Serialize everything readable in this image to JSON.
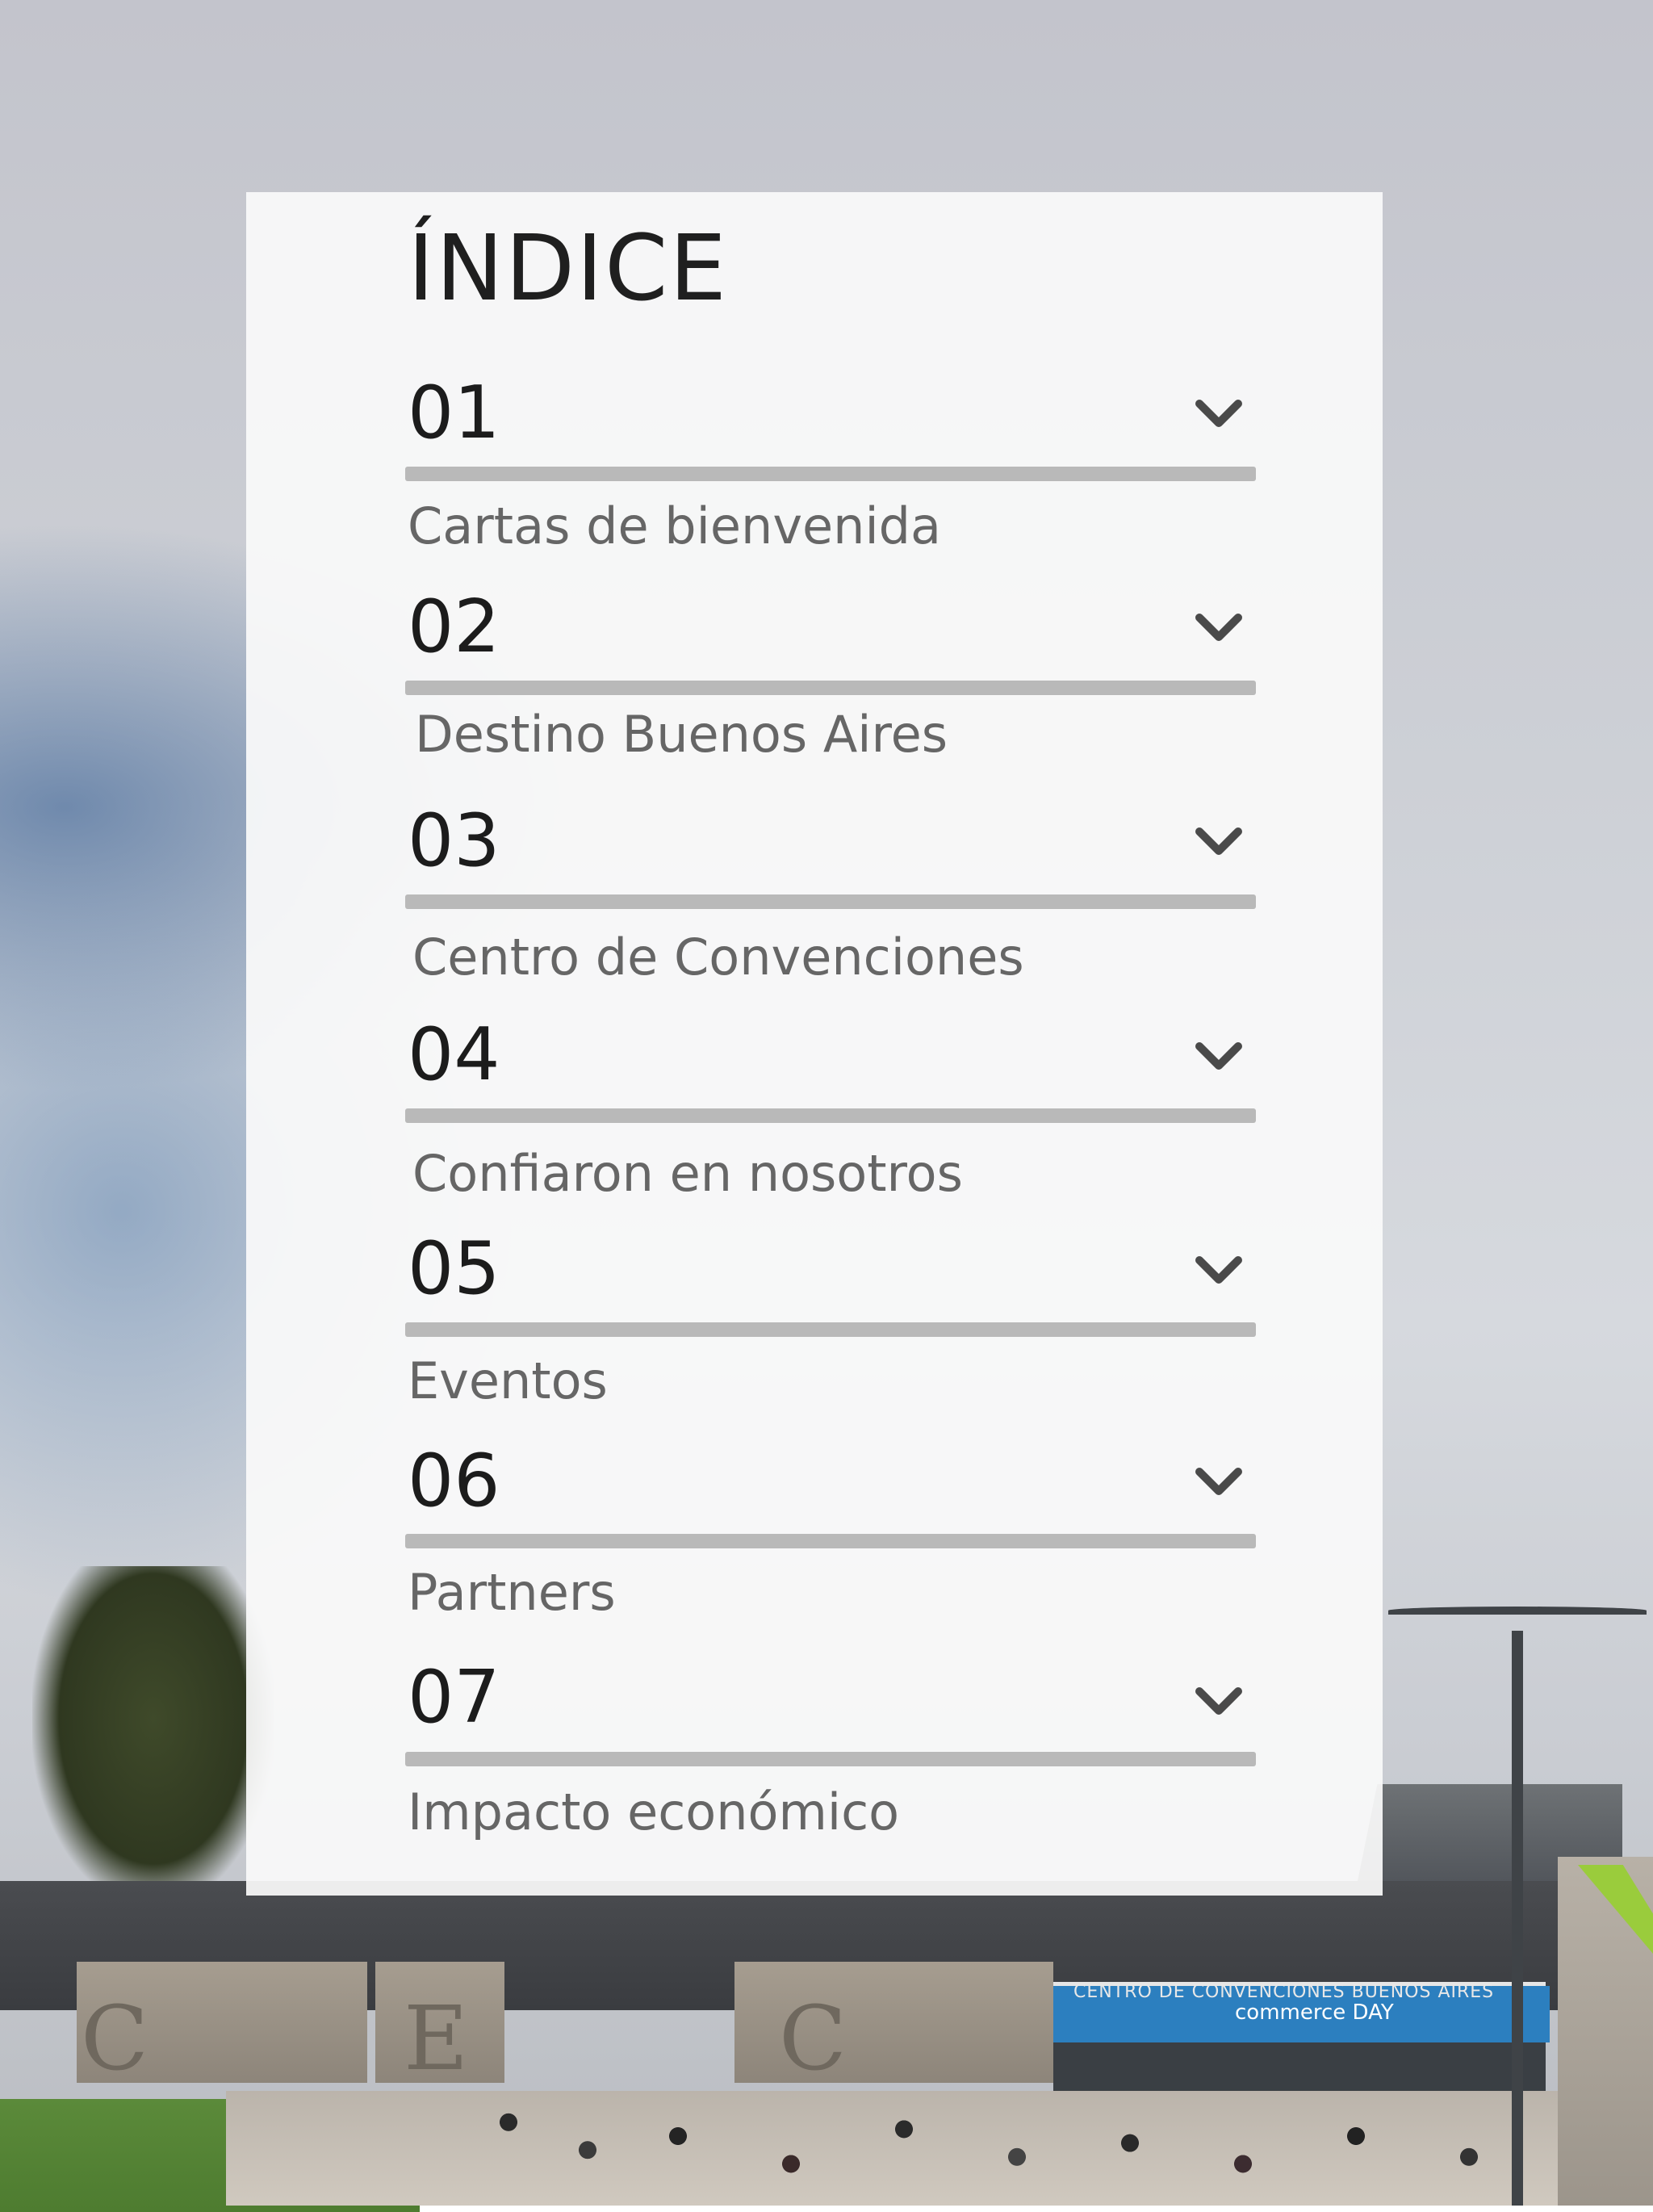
{
  "index": {
    "title": "ÍNDICE",
    "entries": [
      {
        "number": "01",
        "label": "Cartas de bienvenida"
      },
      {
        "number": "02",
        "label": "Destino Buenos Aires"
      },
      {
        "number": "03",
        "label": "Centro de Convenciones"
      },
      {
        "number": "04",
        "label": "Confiaron en nosotros"
      },
      {
        "number": "05",
        "label": "Eventos"
      },
      {
        "number": "06",
        "label": "Partners"
      },
      {
        "number": "07",
        "label": "Impacto económico"
      }
    ]
  },
  "background": {
    "wall_letters": [
      "C",
      "E",
      "C"
    ],
    "building_sign": "CENTRO DE CONVENCIONES BUENOS AIRES",
    "banner_text": "commerce DAY"
  },
  "icons": {
    "expand": "chevron-down-icon"
  },
  "colors": {
    "card": "#fafafa",
    "divider": "#b9b9b9",
    "number_text": "#1c1c1c",
    "label_text": "#666666",
    "banner": "#2c7fbf"
  }
}
